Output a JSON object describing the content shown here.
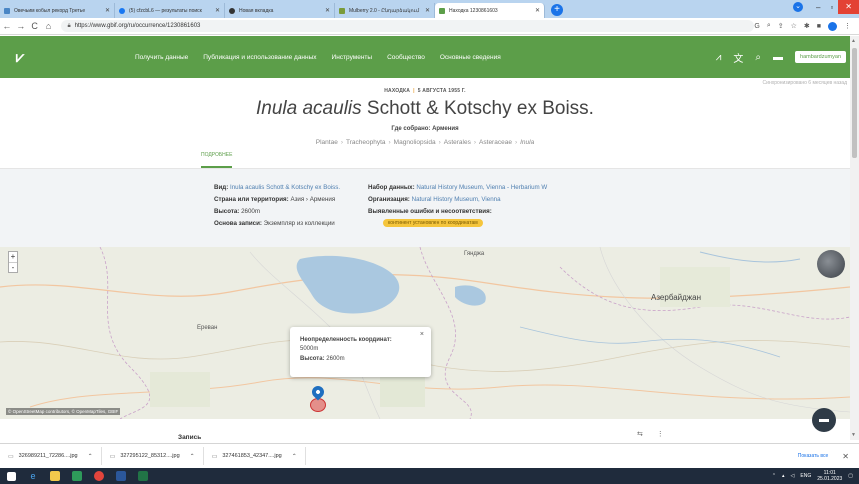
{
  "browser": {
    "tabs": [
      {
        "label": "Овечьим кобыл рекорд Третье",
        "color": "#4a86c5",
        "active": false
      },
      {
        "label": "(5) cfzcbL6 — результаты поиск",
        "color": "#1877f2",
        "active": false
      },
      {
        "label": "Новая вкладка",
        "color": "#333333",
        "active": false
      },
      {
        "label": "Mulberry 2.0 - Ընդարձակում",
        "color": "#7a9b3a",
        "active": false
      },
      {
        "label": "Находка 1230861603",
        "color": "#5c9e49",
        "active": true
      }
    ],
    "new_tab": "+",
    "url": "https://www.gbif.org/ru/occurrence/1230861603",
    "window_controls": {
      "minimize": "–",
      "maximize": "▫",
      "close": "✕"
    }
  },
  "site": {
    "logo": "⩗",
    "nav": [
      "Получить данные",
      "Публикация и использование данных",
      "Инструменты",
      "Сообщество",
      "Основные сведения"
    ],
    "user": "hambardzumyan"
  },
  "occurrence": {
    "synced": "Синхронизировано 6 месяцев назад",
    "kicker": "НАХОДКА",
    "date": "5 АВГУСТА 1955 Г.",
    "title_italic": "Inula acaulis",
    "title_rest": " Schott & Kotschy ex Boiss.",
    "where_label": "Где собрано:",
    "where_value": "Армения",
    "taxonomy": [
      "Plantae",
      "Tracheophyta",
      "Magnoliopsida",
      "Asterales",
      "Asteraceae",
      "Inula"
    ],
    "tab": "ПОДРОБНЕЕ"
  },
  "summary": {
    "view_label": "Вид:",
    "view_value": "Inula acaulis Schott & Kotschy ex Boiss.",
    "country_label": "Страна или территория:",
    "country_value": "Азия › Армения",
    "altitude_label": "Высота:",
    "altitude_value": "2600m",
    "basis_label": "Основа записи:",
    "basis_value": "Экземпляр из коллекции",
    "dataset_label": "Набор данных:",
    "dataset_value": "Natural History Museum, Vienna - Herbarium W",
    "org_label": "Организация:",
    "org_value": "Natural History Museum, Vienna",
    "issues_label": "Выявленные ошибки и несоответствия:",
    "issue_badge": "континент установлен по координатам"
  },
  "map": {
    "zoom_in": "+",
    "zoom_out": "-",
    "labels": {
      "ganja": "Гянджа",
      "azerbaijan": "Азербайджан",
      "yerevan": "Ереван"
    },
    "attribution": "© OpenStreetMap contributors, © OpenMapTiles, GBIF",
    "popup": {
      "uncertainty_label": "Неопределенность координат:",
      "uncertainty_value": "5000m",
      "altitude_label": "Высота:",
      "altitude_value": "2600m",
      "close": "×"
    }
  },
  "record": {
    "heading": "Запись",
    "tools": "⇆ ⋮"
  },
  "downloads": {
    "items": [
      "326989211_72286....jpg",
      "327295122_85312....jpg",
      "327461853_42347....jpg"
    ],
    "show_all": "Показать все",
    "close": "✕"
  },
  "taskbar": {
    "lang": "ENG",
    "time": "11:01",
    "date": "25.01.2023"
  }
}
